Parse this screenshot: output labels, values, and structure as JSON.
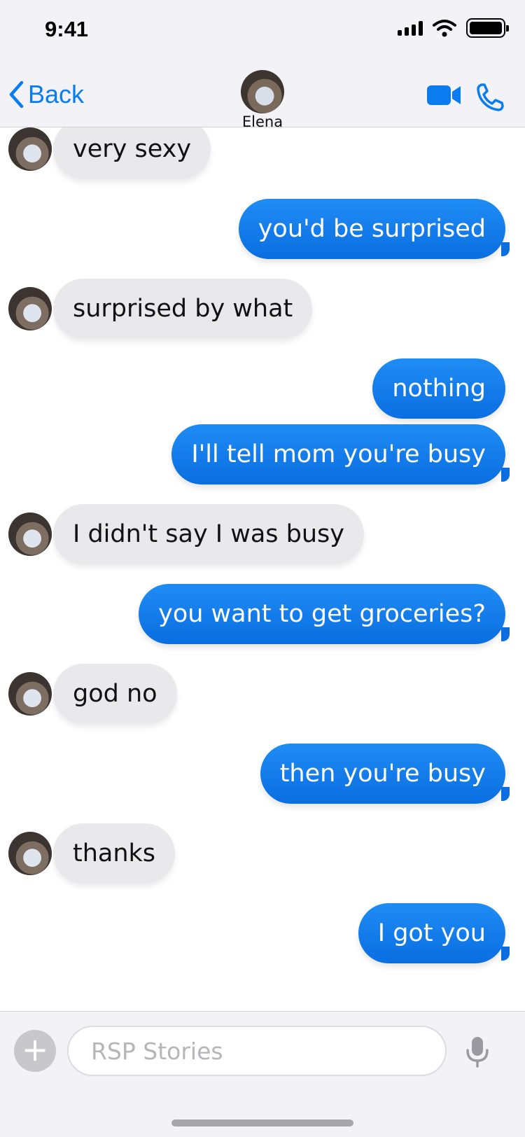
{
  "status_bar": {
    "time": "9:41"
  },
  "header": {
    "back_label": "Back",
    "contact_name": "Elena",
    "icons": [
      "chevron-left-icon",
      "video-camera-icon",
      "phone-icon"
    ]
  },
  "messages": [
    {
      "from": "them",
      "text": "very sexy"
    },
    {
      "from": "me",
      "text": "you'd be surprised"
    },
    {
      "from": "them",
      "text": "surprised by what"
    },
    {
      "from": "me",
      "text": "nothing"
    },
    {
      "from": "me",
      "text": "I'll tell mom you're busy"
    },
    {
      "from": "them",
      "text": "I didn't say I was busy"
    },
    {
      "from": "me",
      "text": "you want to get groceries?"
    },
    {
      "from": "them",
      "text": "god no"
    },
    {
      "from": "me",
      "text": "then you're busy"
    },
    {
      "from": "them",
      "text": "thanks"
    },
    {
      "from": "me",
      "text": "I got you"
    }
  ],
  "composer": {
    "placeholder": "RSP Stories",
    "value": "",
    "icons": [
      "plus-icon",
      "microphone-icon"
    ]
  },
  "colors": {
    "accent": "#0a7cf0",
    "outgoing_bubble": "#0a6ee0",
    "incoming_bubble": "#e9e9eb",
    "header_bg": "#f2f2f7"
  }
}
